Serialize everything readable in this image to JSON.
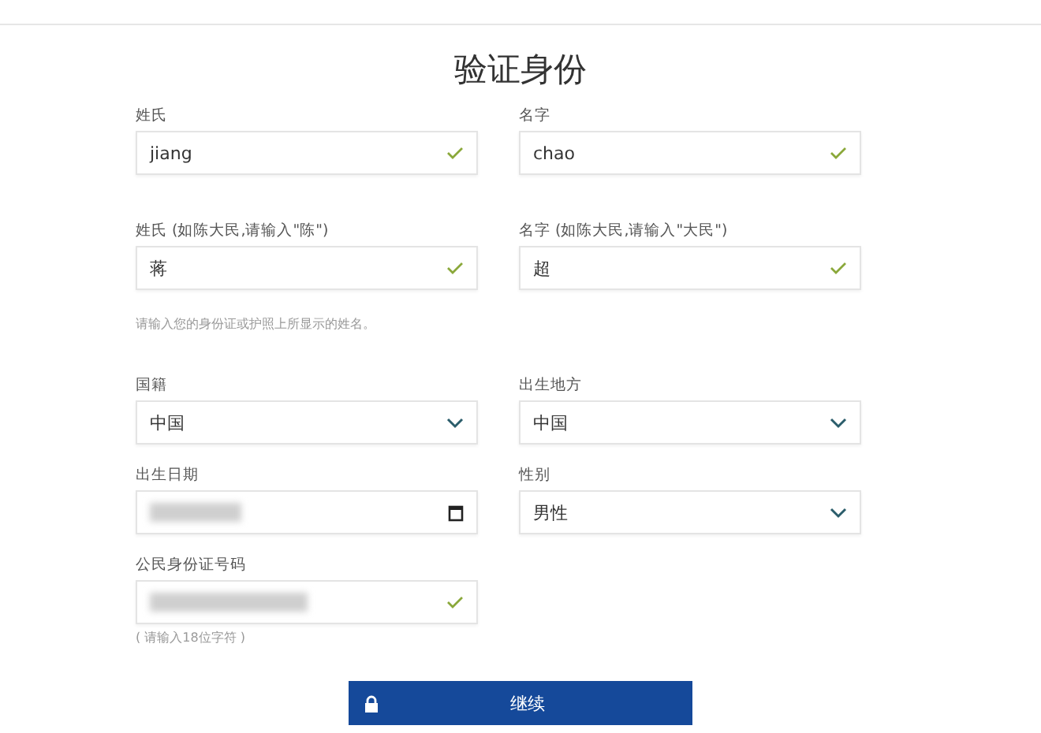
{
  "title": "验证身份",
  "name_section": {
    "rows": [
      {
        "fields": [
          {
            "label": "姓氏",
            "kind": "text",
            "value": "jiang",
            "valid": true
          },
          {
            "label": "名字",
            "kind": "text",
            "value": "chao",
            "valid": true
          }
        ]
      },
      {
        "fields": [
          {
            "label": "姓氏 (如陈大民,请输入\"陈\")",
            "kind": "text",
            "value": "蒋",
            "valid": true
          },
          {
            "label": "名字 (如陈大民,请输入\"大民\")",
            "kind": "text",
            "value": "超",
            "valid": true
          }
        ]
      }
    ],
    "note": "请输入您的身份证或护照上所显示的姓名。"
  },
  "details_section": {
    "rows": [
      {
        "fields": [
          {
            "label": "国籍",
            "kind": "select",
            "value": "中国"
          },
          {
            "label": "出生地方",
            "kind": "select",
            "value": "中国"
          }
        ]
      },
      {
        "fields": [
          {
            "label": "出生日期",
            "kind": "date",
            "redacted": true
          },
          {
            "label": "性别",
            "kind": "select",
            "value": "男性"
          }
        ]
      },
      {
        "fields": [
          {
            "label": "公民身份证号码",
            "kind": "text",
            "redacted": true,
            "valid": true
          }
        ]
      }
    ],
    "note": "( 请输入18位字符 )"
  },
  "submit": {
    "label": "继续"
  }
}
